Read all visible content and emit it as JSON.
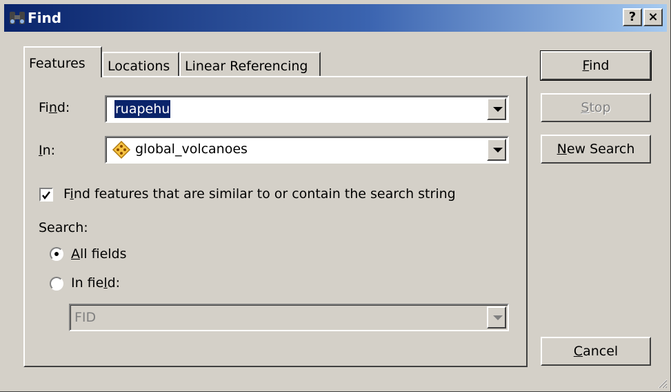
{
  "window": {
    "title": "Find",
    "help_label": "?",
    "close_label": "×"
  },
  "tabs": [
    {
      "label": "Features",
      "active": true
    },
    {
      "label": "Locations",
      "active": false
    },
    {
      "label": "Linear Referencing",
      "active": false
    }
  ],
  "find": {
    "label_pre": "Fi",
    "label_u": "n",
    "label_post": "d:",
    "value": "ruapehu"
  },
  "in": {
    "label_u": "I",
    "label_post": "n:",
    "value": "global_volcanoes",
    "layer_icon": "point-layer-icon"
  },
  "similar": {
    "checked": true,
    "label_pre": "F",
    "label_u": "i",
    "label_post": "nd features that are similar to or contain the search string"
  },
  "search": {
    "label": "Search:",
    "all_fields": {
      "label_u": "A",
      "label_post": "ll fields",
      "selected": true
    },
    "in_field": {
      "label_pre": "In fie",
      "label_u": "l",
      "label_post": "d:",
      "selected": false
    },
    "field_value": "FID"
  },
  "buttons": {
    "find": {
      "u": "F",
      "rest": "ind"
    },
    "stop": {
      "u": "S",
      "rest": "top"
    },
    "new_search": {
      "u": "N",
      "rest": "ew Search"
    },
    "cancel": {
      "u": "C",
      "rest": "ancel"
    }
  },
  "colors": {
    "titlebar_start": "#0a246a",
    "titlebar_end": "#a6caf0",
    "selection": "#0a246a",
    "face": "#d4d0c8"
  }
}
